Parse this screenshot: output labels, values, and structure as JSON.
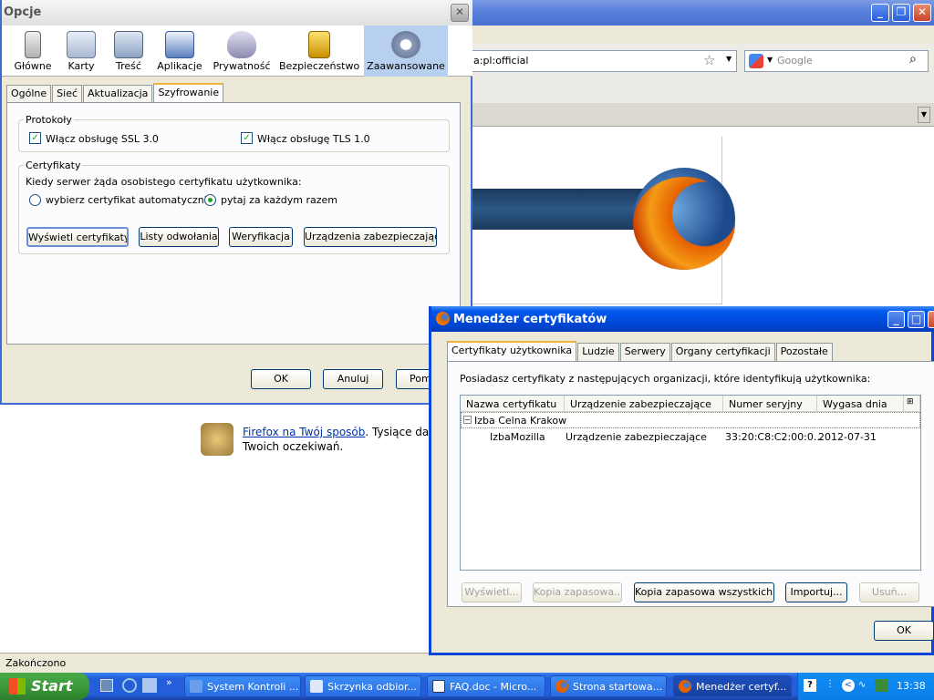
{
  "background_browser": {
    "url": "a:pl:official",
    "search_placeholder": "Google",
    "promo_link": "Firefox na Twój sposób",
    "promo_text": ". Tysiące da",
    "promo_text2": "Twoich oczekiwań.",
    "status": "Zakończono"
  },
  "options_dialog": {
    "title": "Opcje",
    "toolbar": [
      "Główne",
      "Karty",
      "Treść",
      "Aplikacje",
      "Prywatność",
      "Bezpieczeństwo",
      "Zaawansowane"
    ],
    "selected_toolbar": "Zaawansowane",
    "tabs": [
      "Ogólne",
      "Sieć",
      "Aktualizacja",
      "Szyfrowanie"
    ],
    "selected_tab": "Szyfrowanie",
    "protocols_label": "Protokoły",
    "ssl_label": "Włącz obsługę SSL 3.0",
    "ssl_checked": true,
    "tls_label": "Włącz obsługę TLS 1.0",
    "tls_checked": true,
    "certs_label": "Certyfikaty",
    "certs_prompt": "Kiedy serwer żąda osobistego certyfikatu użytkownika:",
    "radio_auto": "wybierz certyfikat automatycznie",
    "radio_ask": "pytaj za każdym razem",
    "selected_radio": "pytaj za każdym razem",
    "buttons": [
      "Wyświetl certyfikaty",
      "Listy odwołania",
      "Weryfikacja",
      "Urządzenia zabezpieczające"
    ],
    "ok": "OK",
    "cancel": "Anuluj",
    "help": "Pomo"
  },
  "cert_manager": {
    "title": "Menedżer certyfikatów",
    "tabs": [
      "Certyfikaty użytkownika",
      "Ludzie",
      "Serwery",
      "Organy certyfikacji",
      "Pozostałe"
    ],
    "selected_tab": "Certyfikaty użytkownika",
    "description": "Posiadasz certyfikaty z następujących organizacji, które identyfikują użytkownika:",
    "columns": [
      "Nazwa certyfikatu",
      "Urządzenie zabezpieczające",
      "Numer seryjny",
      "Wygasa dnia"
    ],
    "org": "Izba Celna Krakow",
    "row": {
      "name": "IzbaMozilla",
      "device": "Urządzenie zabezpieczające",
      "serial": "33:20:C8:C2:00:0...",
      "expires": "2012-07-31"
    },
    "buttons": [
      "Wyświetl...",
      "Kopia zapasowa...",
      "Kopia zapasowa wszystkich...",
      "Importuj...",
      "Usuń..."
    ],
    "ok": "OK"
  },
  "taskbar": {
    "start": "Start",
    "tasks": [
      "System Kontroli ...",
      "Skrzynka odbior...",
      "FAQ.doc - Micro...",
      "Strona startowa...",
      "Menedżer certyf..."
    ],
    "active_task": "Menedżer certyf...",
    "clock": "13:38"
  },
  "colors": {
    "xp_blue": "#0a46d8",
    "firefox_orange": "#e66000",
    "check_green": "#21a121"
  }
}
